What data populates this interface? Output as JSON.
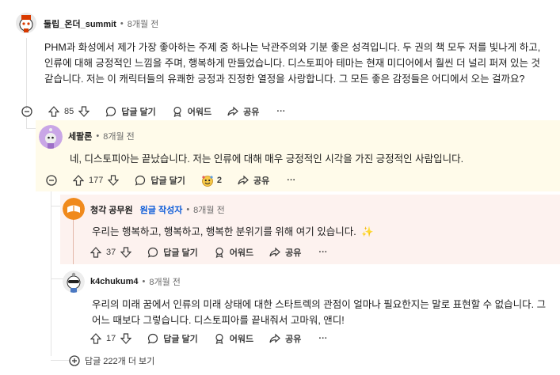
{
  "comments": [
    {
      "username": "둘립_온더_summit",
      "time": "8개월 전",
      "body": "PHM과 화성에서 제가 가장 좋아하는 주제 중 하나는 낙관주의와 기분 좋은 성격입니다. 두 권의 책 모두 저를 빛나게 하고, 인류에 대해 긍정적인 느낌을 주며, 행복하게 만들었습니다. 디스토피아 테마는 현재 미디어에서 훨씬 더 널리 퍼져 있는 것 같습니다. 저는 이 캐릭터들의 유쾌한 긍정과 진정한 열정을 사랑합니다. 그 모든 좋은 감정들은 어디에서 오는 걸까요?",
      "votes": "85",
      "reply": "답글 달기",
      "award": "어워드",
      "share": "공유",
      "more": "···"
    },
    {
      "username": "세팔론",
      "time": "8개월 전",
      "body": "네, 디스토피아는 끝났습니다. 저는 인류에 대해 매우 긍정적인 시각을 가진 긍정적인 사람입니다.",
      "votes": "177",
      "reply": "답글 달기",
      "award_count": "2",
      "share": "공유",
      "more": "···"
    },
    {
      "username": "청각 공무원",
      "badge": "원글 작성자",
      "time": "8개월 전",
      "body": "우리는 행복하고, 행복하고, 행복한 분위기를 위해 여기 있습니다.",
      "emoji": "✨",
      "votes": "37",
      "reply": "답글 달기",
      "award": "어워드",
      "share": "공유",
      "more": "···"
    },
    {
      "username": "k4chukum4",
      "time": "8개월 전",
      "body": "우리의 미래 꿈에서 인류의 미래 상태에 대한 스타트렉의 관점이 얼마나 필요한지는 말로 표현할 수 없습니다. 그 어느 때보다 그렇습니다. 디스토피아를 끝내줘서 고마워, 앤디!",
      "votes": "17",
      "reply": "답글 달기",
      "award": "어워드",
      "share": "공유",
      "more": "···"
    }
  ],
  "more_replies": "답글 222개 더 보기",
  "separator": "•",
  "colors": {
    "highlight_yellow": "#fffbea",
    "highlight_pink": "#fdf2ef",
    "op_badge": "#0a5ad8",
    "thread_line": "#e3e3e3"
  }
}
